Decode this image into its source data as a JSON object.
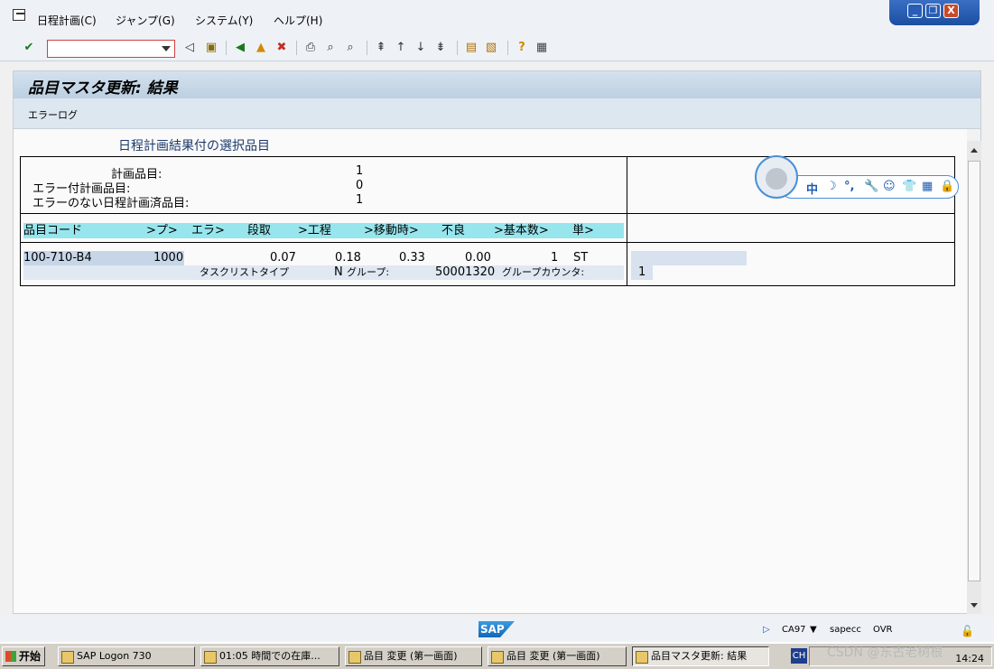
{
  "menu": {
    "items": [
      "日程計画(C)",
      "ジャンプ(G)",
      "システム(Y)",
      "ヘルプ(H)"
    ]
  },
  "window_controls": {
    "minimize": "_",
    "restore": "❐",
    "close": "X"
  },
  "toolbar": {
    "command_field_value": "",
    "icons": [
      "enter-icon",
      "save-icon",
      "back-icon",
      "exit-icon",
      "cancel-icon",
      "print-icon",
      "find-icon",
      "find-next-icon",
      "first-page-icon",
      "prev-page-icon",
      "next-page-icon",
      "last-page-icon",
      "new-session-icon",
      "shortcut-icon",
      "help-icon",
      "layout-icon"
    ]
  },
  "screen": {
    "title": "品目マスタ更新: 結果",
    "app_toolbar_button": "エラーログ"
  },
  "report": {
    "heading": "日程計画結果付の選択品目",
    "stats": [
      {
        "label": "計画品目:",
        "value": "1"
      },
      {
        "label": "エラー付計画品目:",
        "value": "0"
      },
      {
        "label": "エラーのない日程計画済品目:",
        "value": "1"
      }
    ],
    "columns": [
      "品目コード",
      ">プ>",
      "エラ>",
      "段取",
      ">工程",
      ">移動時>",
      "不良",
      ">基本数>",
      "単>"
    ],
    "rows": [
      {
        "material": "100-710-B4",
        "plant": "1000",
        "setup": "0.07",
        "process": "0.18",
        "move": "0.33",
        "scrap": "0.00",
        "base_qty": "1",
        "unit": "ST",
        "task_list_type_label": "タスクリストタイプ",
        "task_list_type": "N",
        "group_label": "グループ:",
        "group": "50001320",
        "group_counter_label": "グループカウンタ:",
        "group_counter": "1"
      }
    ]
  },
  "ime": {
    "glyphs": [
      "中",
      "☽",
      "°,",
      "🔧",
      "☺",
      "👕",
      "▦",
      "🔒"
    ]
  },
  "statusbar": {
    "logo": "SAP",
    "system": "CA97",
    "server": "sapecc",
    "mode": "OVR"
  },
  "taskbar": {
    "start": "开始",
    "buttons": [
      "SAP Logon 730",
      "01:05 時間での在庫...",
      "品目 変更 (第一画面)",
      "品目 変更 (第一画面)",
      "品目マスタ更新: 結果"
    ],
    "lang": "CH",
    "clock": "14:24",
    "watermark": "CSDN @东古老树根"
  }
}
